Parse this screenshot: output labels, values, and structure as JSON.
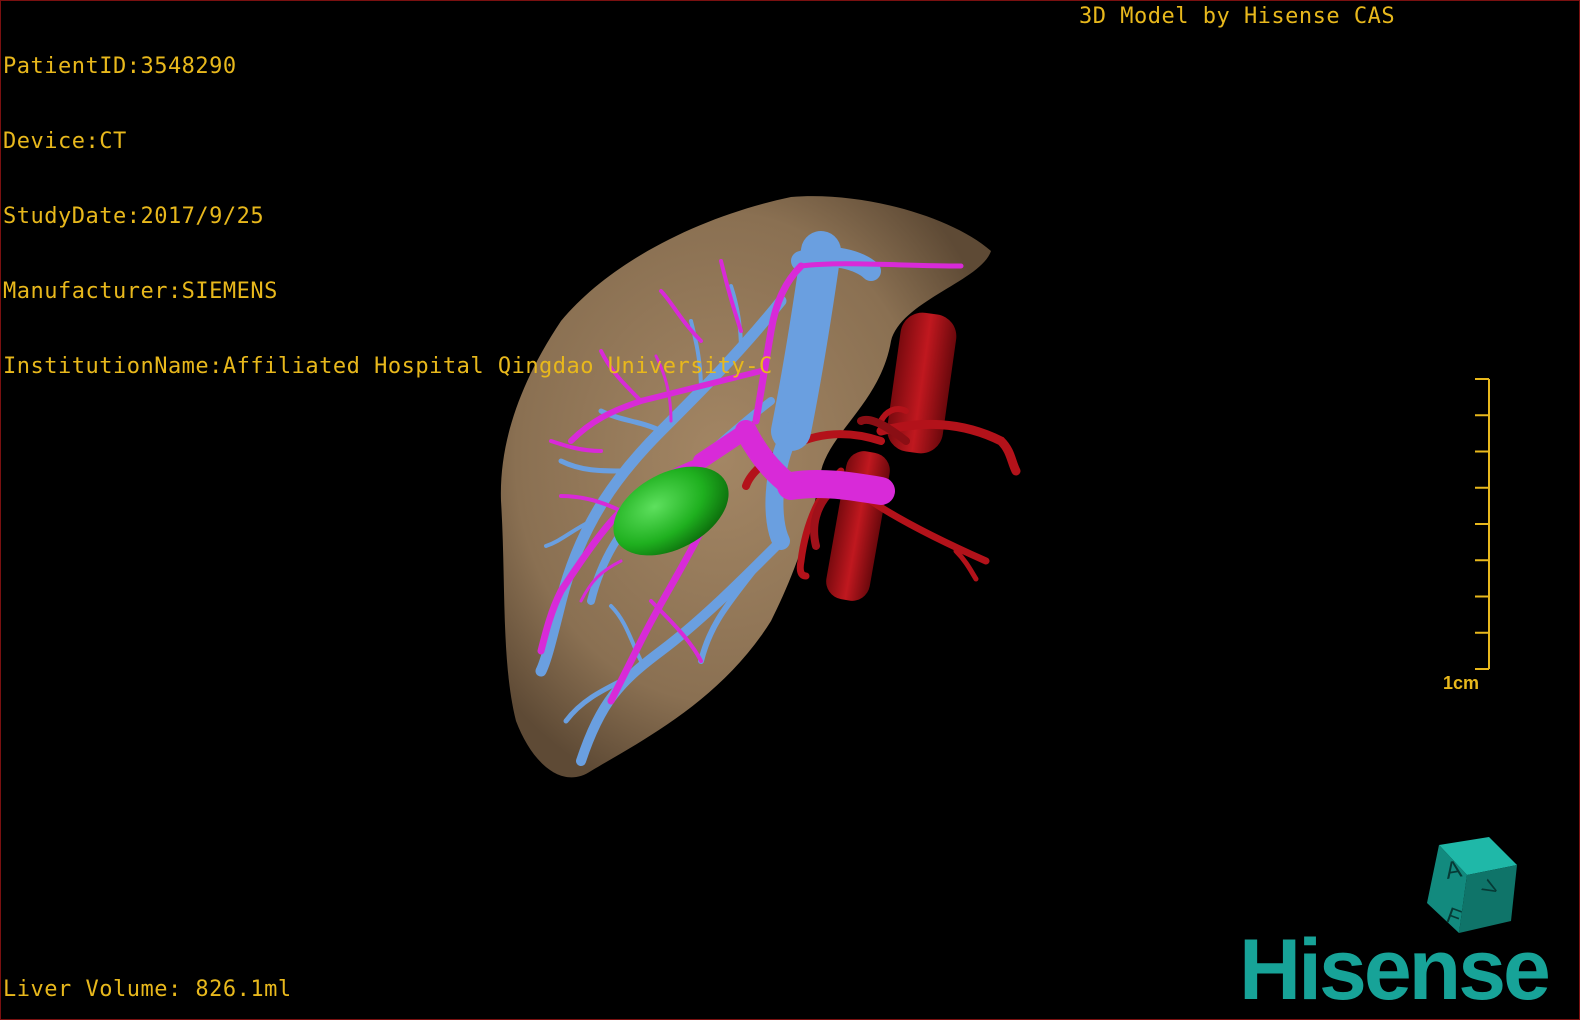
{
  "info": {
    "patient_id": "PatientID:3548290",
    "device": "Device:CT",
    "study_date": "StudyDate:2017/9/25",
    "manufacturer": "Manufacturer:SIEMENS",
    "institution": "InstitutionName:Affiliated Hospital Qingdao University-C"
  },
  "brand_credit": "3D Model by Hisense CAS",
  "liver_volume": "Liver Volume: 826.1ml",
  "scale_bar": {
    "label": "1cm",
    "tick_count": 9
  },
  "orientation_cube": {
    "face_top": "A",
    "face_front": "F",
    "face_side": "V"
  },
  "logo": "Hisense",
  "colors": {
    "overlay_text": "#e8b81c",
    "liver": "#8a7052",
    "hepatic_vein": "#6a9fe0",
    "portal_vein": "#d82ad8",
    "artery_aorta": "#b3121a",
    "lesion": "#1fb01f",
    "logo": "#17a398"
  }
}
